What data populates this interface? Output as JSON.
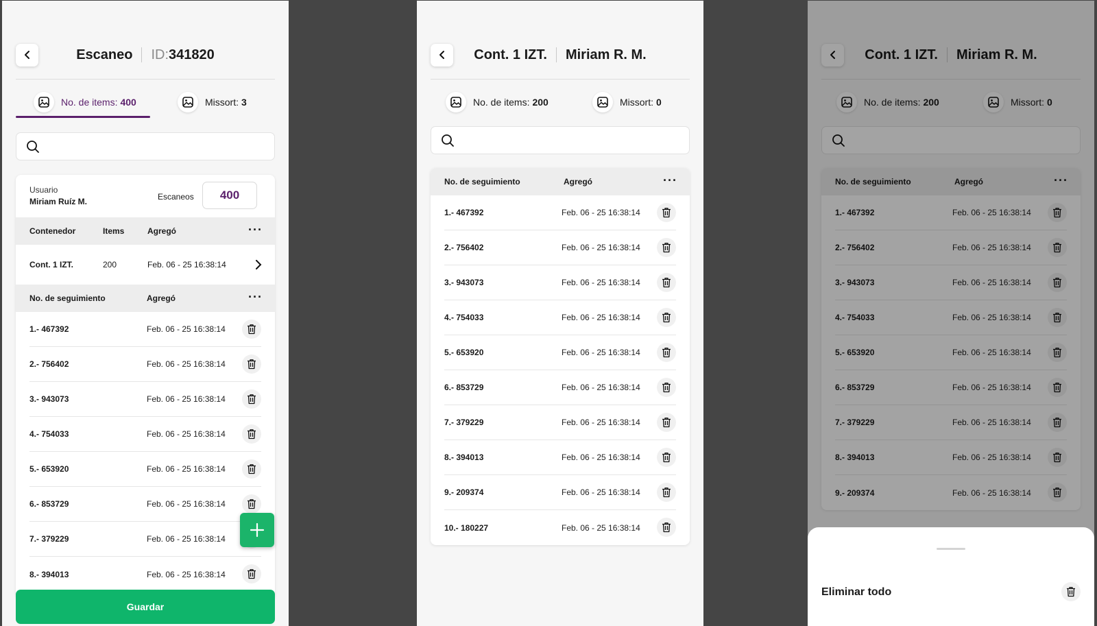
{
  "screen1": {
    "title": "Escaneo",
    "id_label": "ID:",
    "id_value": "341820",
    "stat_items_label": "No. de items:",
    "stat_items_value": "400",
    "stat_missort_label": "Missort:",
    "stat_missort_value": "3",
    "search_placeholder": "",
    "user_label": "Usuario",
    "user_name": "Miriam Ruíz M.",
    "scans_label": "Escaneos",
    "scans_value": "400",
    "containers_header": {
      "col1": "Contenedor",
      "col2": "Items",
      "col3": "Agregó",
      "menu": "···"
    },
    "container_row": {
      "name": "Cont. 1 IZT.",
      "items": "200",
      "date": "Feb. 06 - 25 16:38:14"
    },
    "tracking_header": {
      "col1": "No. de seguimiento",
      "col2": "Agregó",
      "menu": "···"
    },
    "rows": [
      {
        "num": "1.- 467392",
        "date": "Feb. 06 - 25 16:38:14"
      },
      {
        "num": "2.- 756402",
        "date": "Feb. 06 - 25 16:38:14"
      },
      {
        "num": "3.- 943073",
        "date": "Feb. 06 - 25 16:38:14"
      },
      {
        "num": "4.- 754033",
        "date": "Feb. 06 - 25 16:38:14"
      },
      {
        "num": "5.- 653920",
        "date": "Feb. 06 - 25  16:38:14"
      },
      {
        "num": "6.- 853729",
        "date": "Feb. 06 - 25  16:38:14"
      },
      {
        "num": "7.- 379229",
        "date": "Feb. 06 - 25  16:38:14"
      },
      {
        "num": "8.- 394013",
        "date": "Feb. 06 - 25  16:38:14"
      }
    ],
    "save_label": "Guardar"
  },
  "screen2": {
    "title": "Cont. 1 IZT.",
    "subtitle": "Miriam R. M.",
    "stat_items_label": "No. de items:",
    "stat_items_value": "200",
    "stat_missort_label": "Missort:",
    "stat_missort_value": "0",
    "search_placeholder": "",
    "tracking_header": {
      "col1": "No. de seguimiento",
      "col2": "Agregó",
      "menu": "···"
    },
    "rows": [
      {
        "num": "1.- 467392",
        "date": "Feb. 06 - 25 16:38:14"
      },
      {
        "num": "2.- 756402",
        "date": "Feb. 06 - 25 16:38:14"
      },
      {
        "num": "3.- 943073",
        "date": "Feb. 06 - 25 16:38:14"
      },
      {
        "num": "4.- 754033",
        "date": "Feb. 06 - 25 16:38:14"
      },
      {
        "num": "5.- 653920",
        "date": "Feb. 06 - 25  16:38:14"
      },
      {
        "num": "6.- 853729",
        "date": "Feb. 06 - 25  16:38:14"
      },
      {
        "num": "7.- 379229",
        "date": "Feb. 06 - 25  16:38:14"
      },
      {
        "num": "8.- 394013",
        "date": "Feb. 06 - 25  16:38:14"
      },
      {
        "num": "9.- 209374",
        "date": "Feb. 06 - 25  16:38:14"
      },
      {
        "num": "10.- 180227",
        "date": "Feb. 06 - 25  16:38:14"
      }
    ]
  },
  "screen3": {
    "title": "Cont. 1 IZT.",
    "subtitle": "Miriam R. M.",
    "stat_items_label": "No. de items:",
    "stat_items_value": "200",
    "stat_missort_label": "Missort:",
    "stat_missort_value": "0",
    "search_placeholder": "",
    "tracking_header": {
      "col1": "No. de seguimiento",
      "col2": "Agregó",
      "menu": "···"
    },
    "rows": [
      {
        "num": "1.- 467392",
        "date": "Feb. 06 - 25 16:38:14"
      },
      {
        "num": "2.- 756402",
        "date": "Feb. 06 - 25 16:38:14"
      },
      {
        "num": "3.- 943073",
        "date": "Feb. 06 - 25 16:38:14"
      },
      {
        "num": "4.- 754033",
        "date": "Feb. 06 - 25 16:38:14"
      },
      {
        "num": "5.- 653920",
        "date": "Feb. 06 - 25  16:38:14"
      },
      {
        "num": "6.- 853729",
        "date": "Feb. 06 - 25  16:38:14"
      },
      {
        "num": "7.- 379229",
        "date": "Feb. 06 - 25  16:38:14"
      },
      {
        "num": "8.- 394013",
        "date": "Feb. 06 - 25  16:38:14"
      },
      {
        "num": "9.- 209374",
        "date": "Feb. 06 - 25  16:38:14"
      }
    ],
    "sheet_action_label": "Eliminar todo"
  },
  "icons": {
    "back": "chevron-left-icon",
    "image": "image-icon",
    "search": "search-icon",
    "trash": "trash-icon",
    "chevron_right": "chevron-right-icon",
    "add": "plus-icon"
  },
  "colors": {
    "accent": "#5a1f6b",
    "primary_button": "#0fb56b",
    "fab": "#1bb46a"
  }
}
